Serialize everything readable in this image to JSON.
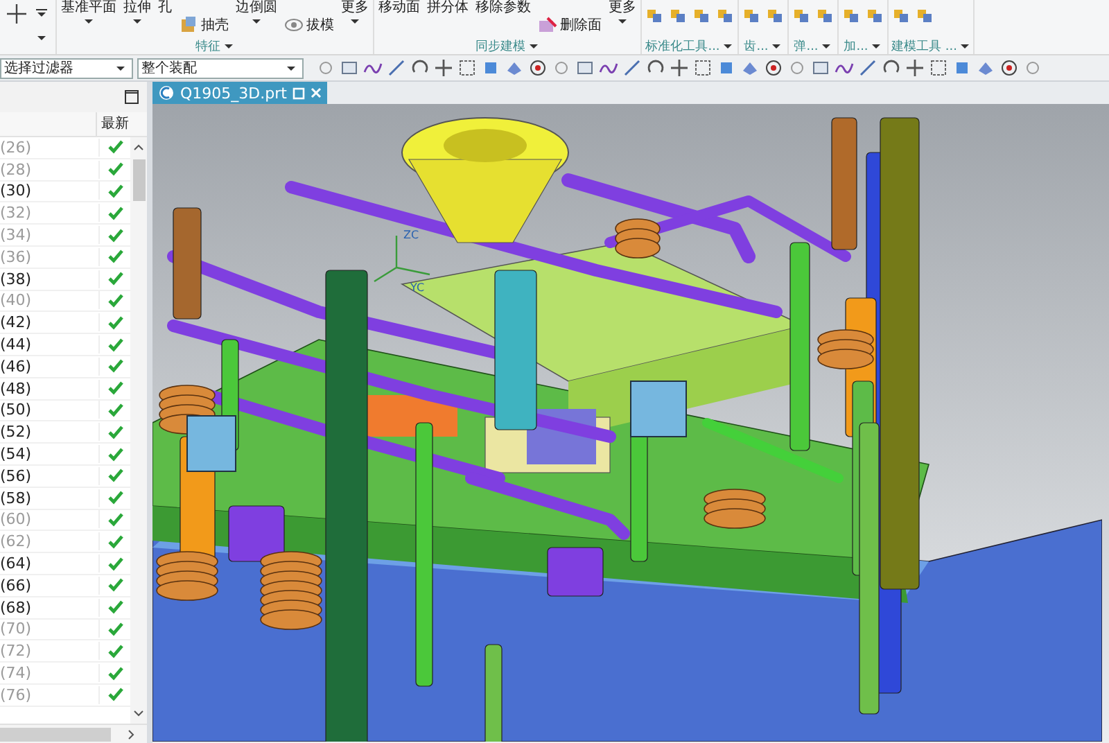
{
  "ribbon": {
    "groups": [
      {
        "label": "特征",
        "buttons": [
          {
            "text": "基准平面",
            "kind": "dropdown"
          },
          {
            "text": "拉伸",
            "kind": "dropdown"
          },
          {
            "text": "孔",
            "kind": "plain"
          },
          {
            "text": "抽壳",
            "kind": "small"
          },
          {
            "text": "边倒圆",
            "kind": "dropdown"
          },
          {
            "text": "拔模",
            "kind": "small"
          },
          {
            "text": "更多",
            "kind": "dropdown"
          }
        ]
      },
      {
        "label": "同步建模",
        "buttons": [
          {
            "text": "移动面",
            "kind": "plain"
          },
          {
            "text": "拼分体",
            "kind": "plain"
          },
          {
            "text": "移除参数",
            "kind": "plain"
          },
          {
            "text": "删除面",
            "kind": "small"
          },
          {
            "text": "更多",
            "kind": "dropdown"
          }
        ]
      },
      {
        "label": "标准化工具..."
      },
      {
        "label": "齿..."
      },
      {
        "label": "弹..."
      },
      {
        "label": "加..."
      },
      {
        "label": "建模工具 ..."
      }
    ]
  },
  "selection_bar": {
    "filter": "选择过滤器",
    "scope": "整个装配"
  },
  "navigator": {
    "column_2": "最新",
    "rows": [
      {
        "label": "(26)",
        "dimmed": true,
        "latest": true
      },
      {
        "label": "(28)",
        "dimmed": true,
        "latest": true
      },
      {
        "label": "(30)",
        "dimmed": false,
        "latest": true
      },
      {
        "label": "(32)",
        "dimmed": true,
        "latest": true
      },
      {
        "label": "(34)",
        "dimmed": true,
        "latest": true
      },
      {
        "label": "(36)",
        "dimmed": true,
        "latest": true
      },
      {
        "label": "(38)",
        "dimmed": false,
        "latest": true
      },
      {
        "label": "(40)",
        "dimmed": true,
        "latest": true
      },
      {
        "label": "(42)",
        "dimmed": false,
        "latest": true
      },
      {
        "label": "(44)",
        "dimmed": false,
        "latest": true
      },
      {
        "label": "(46)",
        "dimmed": false,
        "latest": true
      },
      {
        "label": "(48)",
        "dimmed": false,
        "latest": true
      },
      {
        "label": "(50)",
        "dimmed": false,
        "latest": true
      },
      {
        "label": "(52)",
        "dimmed": false,
        "latest": true
      },
      {
        "label": "(54)",
        "dimmed": false,
        "latest": true
      },
      {
        "label": "(56)",
        "dimmed": false,
        "latest": true
      },
      {
        "label": "(58)",
        "dimmed": false,
        "latest": true
      },
      {
        "label": "(60)",
        "dimmed": true,
        "latest": true
      },
      {
        "label": "(62)",
        "dimmed": true,
        "latest": true
      },
      {
        "label": "(64)",
        "dimmed": false,
        "latest": true
      },
      {
        "label": "(66)",
        "dimmed": false,
        "latest": true
      },
      {
        "label": "(68)",
        "dimmed": false,
        "latest": true
      },
      {
        "label": "(70)",
        "dimmed": true,
        "latest": true
      },
      {
        "label": "(72)",
        "dimmed": true,
        "latest": true
      },
      {
        "label": "(74)",
        "dimmed": true,
        "latest": true
      },
      {
        "label": "(76)",
        "dimmed": true,
        "latest": true
      }
    ]
  },
  "document_tab": {
    "title": "Q1905_3D.prt",
    "selected": true
  },
  "viewport": {
    "axis_labels": [
      "ZC",
      "YC"
    ]
  }
}
